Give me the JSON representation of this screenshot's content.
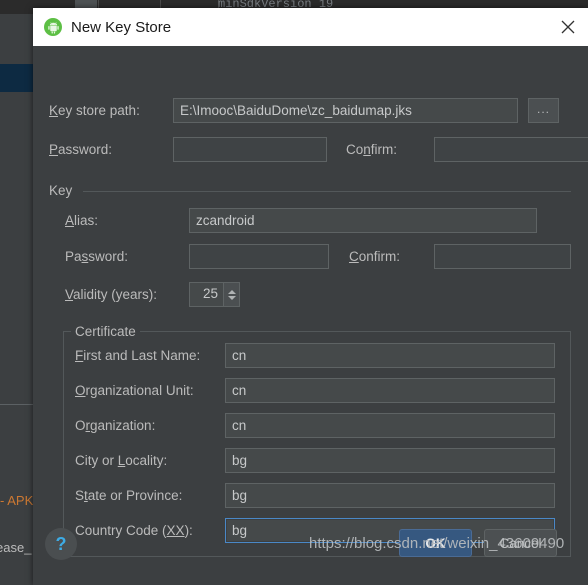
{
  "background": {
    "code_text": "minSdkVersion 19",
    "log_apk": "- APK",
    "log_release": "ease_"
  },
  "dialog": {
    "title": "New Key Store",
    "title_icon": "android-studio-icon",
    "close_icon": "close-icon",
    "keystore": {
      "path_label_pre": "",
      "path_label_mnemonic": "K",
      "path_label_post": "ey store path:",
      "path_value": "E:\\Imooc\\BaiduDome\\zc_baidumap.jks",
      "browse_label": "...",
      "password_label_mnemonic": "P",
      "password_label_post": "assword:",
      "password_value": "",
      "confirm_label_pre": "Co",
      "confirm_label_mnemonic": "n",
      "confirm_label_post": "firm:",
      "confirm_value": ""
    },
    "key_group": {
      "legend": "Key",
      "alias_label_mnemonic": "A",
      "alias_label_post": "lias:",
      "alias_value": "zcandroid",
      "password_label_pre": "Pa",
      "password_label_mnemonic": "s",
      "password_label_post": "sword:",
      "password_value": "",
      "confirm_label_mnemonic": "C",
      "confirm_label_post": "onfirm:",
      "confirm_value": "",
      "validity_label_mnemonic": "V",
      "validity_label_post": "alidity (years):",
      "validity_value": "25"
    },
    "certificate": {
      "legend": "Certificate",
      "rows": [
        {
          "label_pre": "",
          "label_mnemonic": "F",
          "label_post": "irst and Last Name:",
          "value": "cn",
          "focused": false,
          "name": "first-and-last-name"
        },
        {
          "label_pre": "",
          "label_mnemonic": "O",
          "label_post": "rganizational Unit:",
          "value": "cn",
          "focused": false,
          "name": "organizational-unit"
        },
        {
          "label_pre": "O",
          "label_mnemonic": "r",
          "label_post": "ganization:",
          "value": "cn",
          "focused": false,
          "name": "organization"
        },
        {
          "label_pre": "City or ",
          "label_mnemonic": "L",
          "label_post": "ocality:",
          "value": "bg",
          "focused": false,
          "name": "city-or-locality"
        },
        {
          "label_pre": "S",
          "label_mnemonic": "t",
          "label_post": "ate or Province:",
          "value": "bg",
          "focused": false,
          "name": "state-or-province"
        },
        {
          "label_pre": "Country Code (",
          "label_mnemonic": "XX",
          "label_post": "):",
          "value": "bg",
          "focused": true,
          "name": "country-code"
        }
      ]
    },
    "footer": {
      "help_label": "?",
      "ok_label": "OK",
      "cancel_label": "Cancel",
      "watermark": "https://blog.csdn.net/weixin_43609490"
    }
  },
  "colors": {
    "dialog_bg": "#3c3f41",
    "input_bg": "#45494a",
    "focus_border": "#4a88c7",
    "ok_button": "#365880",
    "title_bar": "#ffffff",
    "text": "#bbbbbb",
    "help_blue": "#3dabe5"
  }
}
